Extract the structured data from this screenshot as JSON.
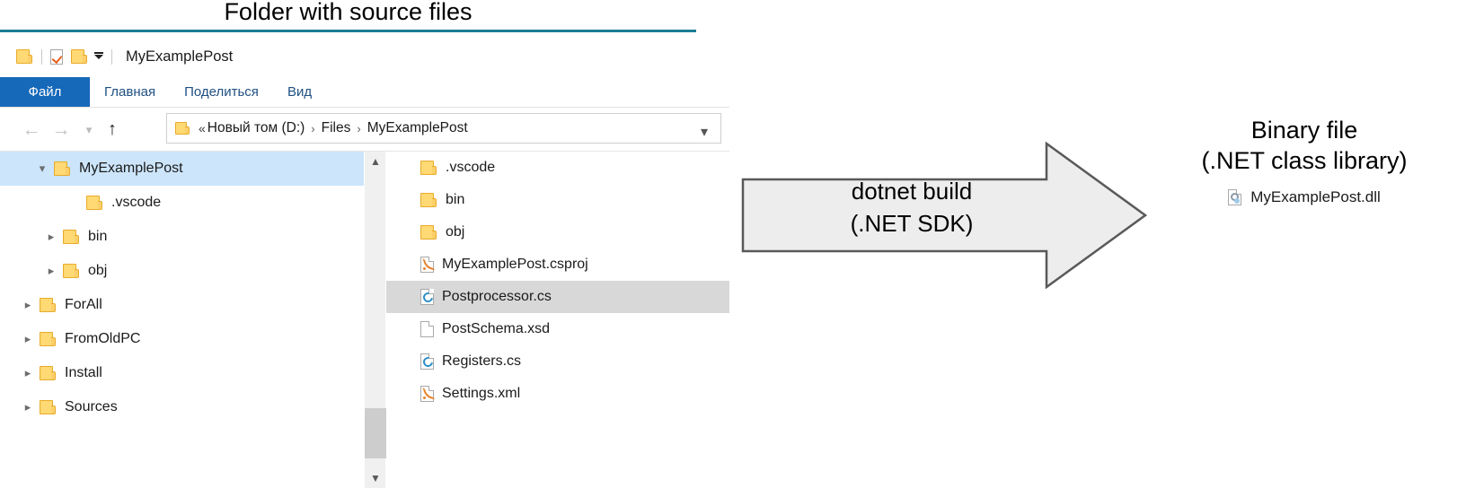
{
  "diagram": {
    "title": "Folder with source files",
    "rule_color": "#1b7d94",
    "arrow": {
      "line1": "dotnet build",
      "line2": "(.NET SDK)",
      "fill": "#ededed",
      "border": "#595959"
    },
    "output": {
      "caption_line1": "Binary file",
      "caption_line2": "(.NET class library)",
      "file_name": "MyExamplePost.dll",
      "file_icon": "dll-file-icon"
    }
  },
  "explorer": {
    "titlebar": {
      "title": "MyExamplePost",
      "quick_access": [
        {
          "icon": "folder-icon"
        },
        {
          "icon": "properties-check-icon"
        },
        {
          "icon": "new-folder-icon"
        },
        {
          "icon": "customize-quick-access-chevron-icon"
        }
      ]
    },
    "ribbon": {
      "tabs": [
        {
          "label": "Файл",
          "active": true
        },
        {
          "label": "Главная",
          "active": false
        },
        {
          "label": "Поделиться",
          "active": false
        },
        {
          "label": "Вид",
          "active": false
        }
      ],
      "file_tab_color": "#1668b9"
    },
    "navigation": {
      "back_icon": "arrow-left-icon",
      "forward_icon": "arrow-right-icon",
      "recent_icon": "chevron-down-icon",
      "up_icon": "arrow-up-icon",
      "address": {
        "prefix": "«",
        "crumbs": [
          "Новый том (D:)",
          "Files",
          "MyExamplePost"
        ],
        "separator": "›",
        "dropdown_icon": "chevron-down-icon"
      }
    },
    "tree": {
      "items": [
        {
          "label": "MyExamplePost",
          "indent": 1,
          "chevron": "expanded",
          "selected": true
        },
        {
          "label": ".vscode",
          "indent": 2,
          "chevron": "none",
          "selected": false
        },
        {
          "label": "bin",
          "indent": 2,
          "chevron": "collapsed",
          "selected": false
        },
        {
          "label": "obj",
          "indent": 2,
          "chevron": "collapsed",
          "selected": false
        },
        {
          "label": "ForAll",
          "indent": 1,
          "chevron": "collapsed",
          "selected": false
        },
        {
          "label": "FromOldPC",
          "indent": 1,
          "chevron": "collapsed",
          "selected": false
        },
        {
          "label": "Install",
          "indent": 1,
          "chevron": "collapsed",
          "selected": false
        },
        {
          "label": "Sources",
          "indent": 1,
          "chevron": "collapsed",
          "selected": false
        }
      ],
      "scrollbar": {
        "up_icon": "chevron-up-icon",
        "down_icon": "chevron-down-icon"
      }
    },
    "files": {
      "items": [
        {
          "label": ".vscode",
          "type": "folder",
          "highlighted": false
        },
        {
          "label": "bin",
          "type": "folder",
          "highlighted": false
        },
        {
          "label": "obj",
          "type": "folder",
          "highlighted": false
        },
        {
          "label": "MyExamplePost.csproj",
          "type": "xml",
          "highlighted": false
        },
        {
          "label": "Postprocessor.cs",
          "type": "cs",
          "highlighted": true
        },
        {
          "label": "PostSchema.xsd",
          "type": "blank",
          "highlighted": false
        },
        {
          "label": "Registers.cs",
          "type": "cs",
          "highlighted": false
        },
        {
          "label": "Settings.xml",
          "type": "xml",
          "highlighted": false
        }
      ]
    }
  }
}
